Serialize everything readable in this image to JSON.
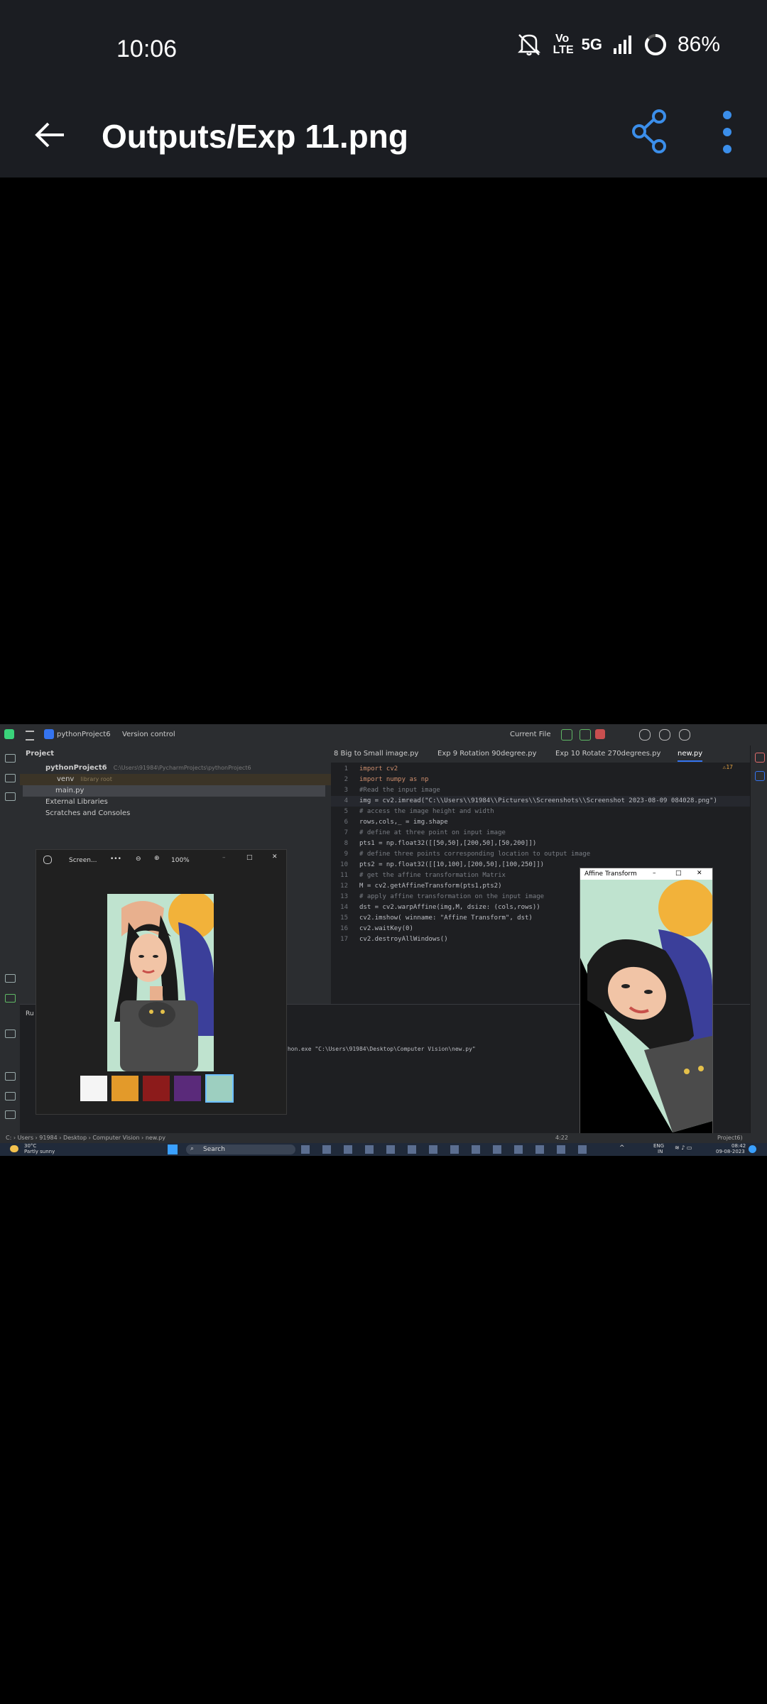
{
  "status_bar": {
    "time": "10:06",
    "network_label": "Vo LTE",
    "network_type": "5G",
    "battery": "86%"
  },
  "app_bar": {
    "title": "Outputs/Exp 11.png",
    "icons": [
      "back-arrow-icon",
      "share-icon",
      "more-vert-icon"
    ]
  },
  "screenshot": {
    "ide": {
      "project_name": "pythonProject6",
      "version_control": "Version control",
      "run_config": "Current File",
      "project_label": "Project",
      "tree": [
        {
          "label": "pythonProject6",
          "path": "C:\\Users\\91984\\PycharmProjects\\pythonProject6"
        },
        {
          "label": "venv",
          "path": "library root"
        },
        {
          "label": "main.py",
          "path": ""
        },
        {
          "label": "External Libraries",
          "path": ""
        },
        {
          "label": "Scratches and Consoles",
          "path": ""
        }
      ],
      "tabs": [
        "8 Big to Small image.py",
        "Exp 9 Rotation 90degree.py",
        "Exp 10 Rotate 270degrees.py",
        "new.py"
      ],
      "warning_count": "17",
      "code": [
        "import cv2",
        "import numpy as np",
        "#Read the input image",
        "img = cv2.imread(\"C:\\\\Users\\\\91984\\\\Pictures\\\\Screenshots\\\\Screenshot 2023-08-09 084028.png\")",
        "# access the image height and width",
        "rows,cols,_ = img.shape",
        "# define at three point on input image",
        "pts1 = np.float32([[50,50],[200,50],[50,200]])",
        "# define three points corresponding location to output image",
        "pts2 = np.float32([[10,100],[200,50],[100,250]])",
        "# get the affine transformation Matrix",
        "M = cv2.getAffineTransform(pts1,pts2)",
        "# apply affine transformation on the input image",
        "dst = cv2.warpAffine(img,M, dsize: (cols,rows))",
        "cv2.imshow( winname: \"Affine Transform\", dst)",
        "cv2.waitKey(0)",
        "cv2.destroyAllWindows()"
      ],
      "run_label": "Ru",
      "console_text": "thon.exe \"C:\\Users\\91984\\Desktop\\Computer Vision\\new.py\"",
      "breadcrumb": [
        "C:",
        "Users",
        "91984",
        "Desktop",
        "Computer Vision",
        "new.py"
      ],
      "cursor_pos": "4:22",
      "status_right": "Project6)"
    },
    "photos_viewer": {
      "title": "Screen...",
      "more": "•••",
      "zoom": "100%"
    },
    "affine_window": {
      "title": "Affine Transform"
    },
    "taskbar": {
      "weather_temp": "30°C",
      "weather_desc": "Partly sunny",
      "search_label": "Search",
      "lang": "ENG",
      "region": "IN",
      "clock_time": "08:42",
      "clock_date": "09-08-2023"
    }
  },
  "colors": {
    "bar_bg": "#1b1d22",
    "share_blue": "#3b8eea",
    "ide_bg": "#1e1f22"
  }
}
